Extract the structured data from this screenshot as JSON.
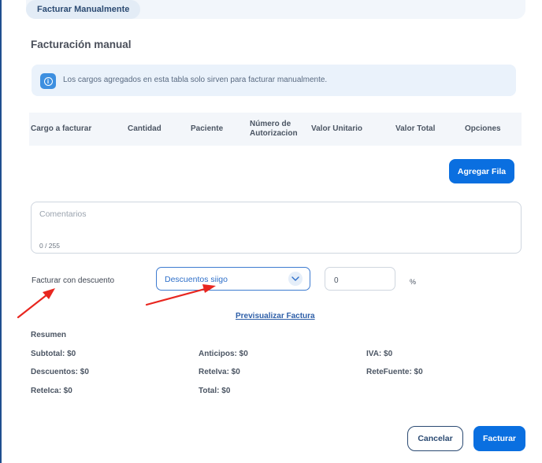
{
  "tab": {
    "label": "Facturar Manualmente"
  },
  "section_title": "Facturación manual",
  "info": {
    "text": "Los cargos agregados en esta tabla solo sirven para facturar manualmente."
  },
  "table": {
    "columns": [
      "Cargo a facturar",
      "Cantidad",
      "Paciente",
      "Número de Autorizacion",
      "Valor Unitario",
      "Valor Total",
      "Opciones"
    ]
  },
  "add_row_label": "Agregar Fila",
  "comments": {
    "placeholder": "Comentarios",
    "counter": "0 / 255"
  },
  "discount": {
    "label": "Facturar con descuento",
    "select_value": "Descuentos siigo",
    "percent_value": "0",
    "percent_symbol": "%"
  },
  "preview_link": "Previsualizar Factura",
  "summary": {
    "title": "Resumen",
    "subtotal": "Subtotal: $0",
    "anticipos": "Anticipos: $0",
    "iva": "IVA: $0",
    "descuentos": "Descuentos: $0",
    "reteiva": "ReteIva: $0",
    "retefuente": "ReteFuente: $0",
    "reteica": "ReteIca: $0",
    "total": "Total: $0"
  },
  "actions": {
    "cancel": "Cancelar",
    "submit": "Facturar"
  },
  "colors": {
    "primary": "#0a6fe0",
    "annotation": "#e8261f",
    "info_bg": "#eaf2fb"
  }
}
